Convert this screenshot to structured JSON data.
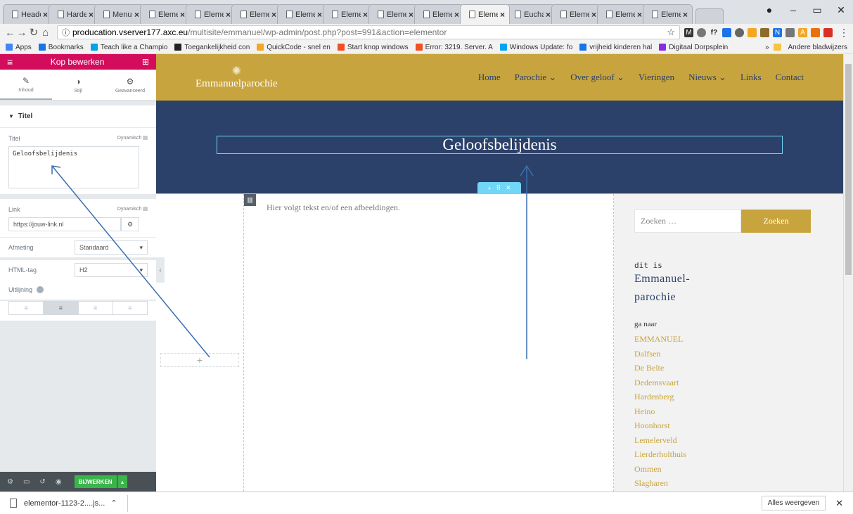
{
  "browser": {
    "tabs": [
      {
        "label": "Header"
      },
      {
        "label": "Harder"
      },
      {
        "label": "Menu"
      },
      {
        "label": "Elemen"
      },
      {
        "label": "Elemen"
      },
      {
        "label": "Elemen"
      },
      {
        "label": "Elemen"
      },
      {
        "label": "Elemen"
      },
      {
        "label": "Elemen"
      },
      {
        "label": "Elemen"
      },
      {
        "label": "Elemen",
        "active": true
      },
      {
        "label": "Euchar"
      },
      {
        "label": "Elemen"
      },
      {
        "label": "Elemen"
      },
      {
        "label": "Elemen"
      }
    ],
    "url_host": "producation.vserver177.axc.eu",
    "url_path": "/multisite/emmanuel/wp-admin/post.php?post=991&action=elementor",
    "bookmarks": [
      {
        "label": "Apps",
        "color": "#4285f4"
      },
      {
        "label": "Bookmarks",
        "color": "#1a73e8"
      },
      {
        "label": "Teach like a Champio",
        "color": "#00a2e8"
      },
      {
        "label": "Toegankelijkheid con",
        "color": "#222222"
      },
      {
        "label": "QuickCode - snel en",
        "color": "#f5a623"
      },
      {
        "label": "Start knop windows",
        "color": "#f25022"
      },
      {
        "label": "Error: 3219. Server. A",
        "color": "#f25022"
      },
      {
        "label": "Windows Update: fo",
        "color": "#00a4ef"
      },
      {
        "label": "vrijheid kinderen hal",
        "color": "#1a73e8"
      },
      {
        "label": "Digitaal Dorpsplein",
        "color": "#8a2be2"
      }
    ],
    "bookmarks_more": "»",
    "other_bookmarks": "Andere bladwijzers"
  },
  "panel": {
    "title": "Kop bewerken",
    "tabs": [
      {
        "label": "Inhoud",
        "glyph": "✎"
      },
      {
        "label": "Stijl",
        "glyph": "◑"
      },
      {
        "label": "Geavanceerd",
        "glyph": "⚙"
      }
    ],
    "section": "Titel",
    "title_label": "Titel",
    "dynamic": "Dynamisch",
    "title_value": "Geloofsbelijdenis",
    "link_label": "Link",
    "link_placeholder": "https://jouw-link.nl",
    "size_label": "Afmeting",
    "size_value": "Standaard",
    "tag_label": "HTML-tag",
    "tag_value": "H2",
    "align_label": "Uitlijning",
    "update_button": "BIJWERKEN"
  },
  "site": {
    "logo": "Emmanuelparochie",
    "menu": [
      "Home",
      "Parochie ⌄",
      "Over geloof ⌄",
      "Vieringen",
      "Nieuws ⌄",
      "Links",
      "Contact"
    ],
    "heading": "Geloofsbelijdenis",
    "placeholder_text": "Hier volgt tekst en/of een afbeeldingen.",
    "search_placeholder": "Zoeken …",
    "search_button": "Zoeken",
    "sidebar_small": "dit is",
    "sidebar_big_1": "Emmanuel-",
    "sidebar_big_2": "parochie",
    "goto": "ga naar",
    "links": [
      "EMMANUEL",
      "Dalfsen",
      "De Belte",
      "Dedemsvaart",
      "Hardenberg",
      "Heino",
      "Hoonhorst",
      "Lemelerveld",
      "Lierderholthuis",
      "Ommen",
      "Slagharen"
    ]
  },
  "download": {
    "file": "elementor-1123-2....js...",
    "show_all": "Alles weergeven"
  },
  "colors": {
    "accent": "#d30c5c",
    "gold": "#c8a43e",
    "navy": "#2c4169",
    "edit": "#71d7f7"
  }
}
